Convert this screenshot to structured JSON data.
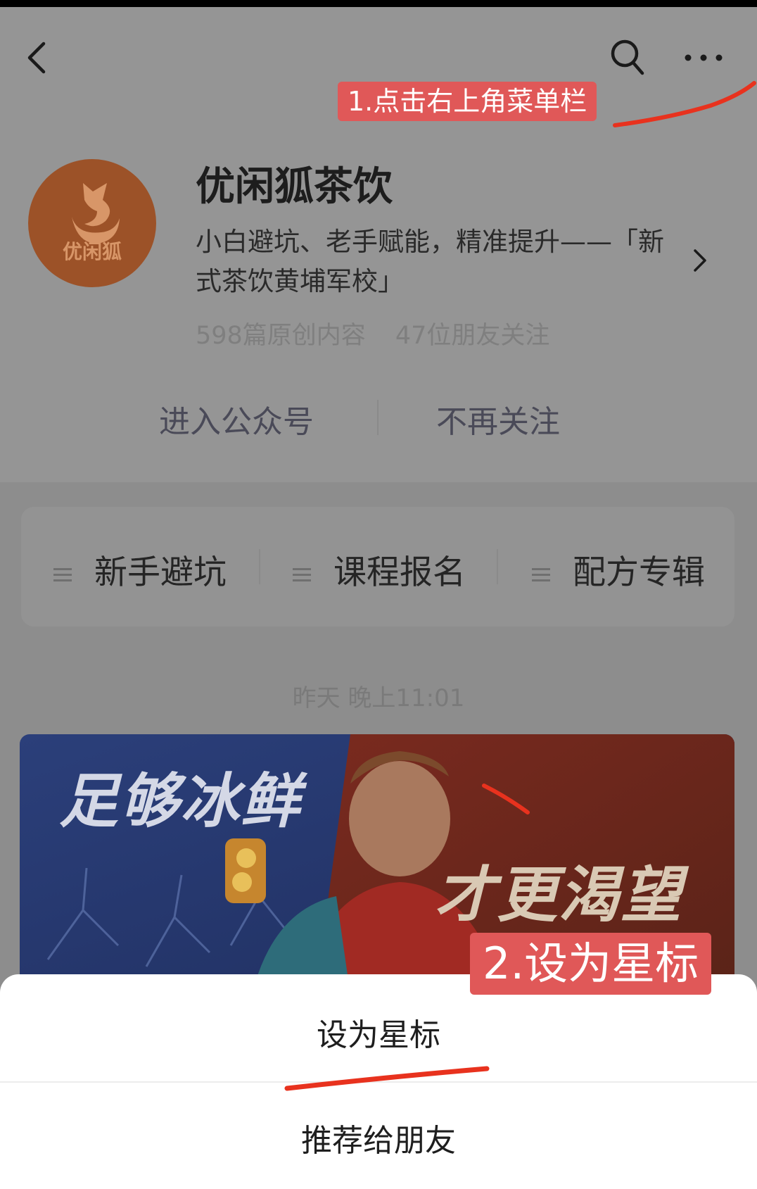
{
  "header": {
    "annotation_step1": "1.点击右上角菜单栏"
  },
  "account": {
    "avatar_text": "优闲狐",
    "name": "优闲狐茶饮",
    "description": "小白避坑、老手赋能，精准提升——「新式茶饮黄埔军校」",
    "stats": {
      "articles": "598篇原创内容",
      "friends": "47位朋友关注"
    },
    "actions": {
      "enter": "进入公众号",
      "unfollow": "不再关注"
    }
  },
  "menu": {
    "items": [
      {
        "label": "新手避坑"
      },
      {
        "label": "课程报名"
      },
      {
        "label": "配方专辑"
      }
    ]
  },
  "feed": {
    "timestamp": "昨天 晚上11:01",
    "banner_text_left": "足够冰鲜",
    "banner_text_right": "才更渴望"
  },
  "sheet": {
    "annotation_step2": "2.设为星标",
    "options": [
      {
        "label": "设为星标"
      },
      {
        "label": "推荐给朋友"
      }
    ]
  },
  "colors": {
    "annotation": "#e05858",
    "stroke": "#e8321e",
    "overlay": "#8d8d8d"
  }
}
